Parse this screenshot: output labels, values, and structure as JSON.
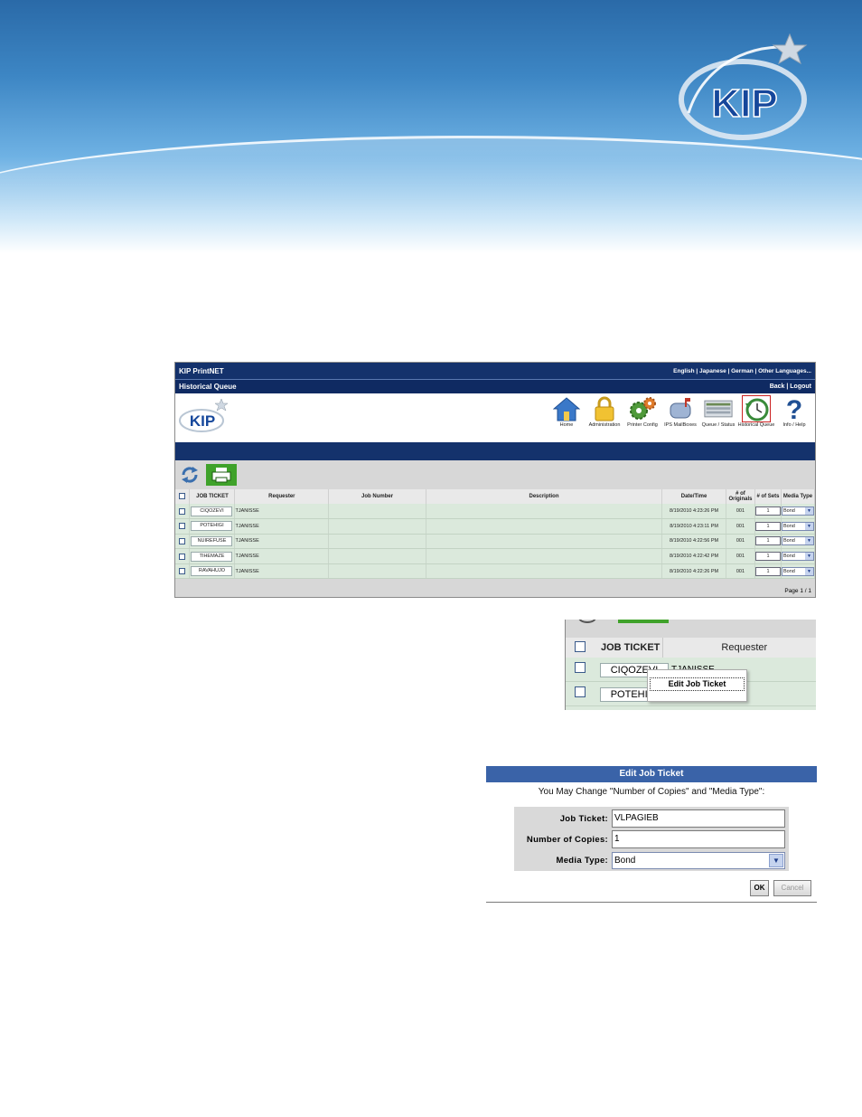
{
  "banner": {
    "logo_text": "KIP"
  },
  "app": {
    "title": "KIP PrintNET",
    "languages": "English | Japanese | German | Other Languages...",
    "page_name": "Historical Queue",
    "links": "Back | Logout",
    "logo_text": "KIP",
    "nav": [
      {
        "label": "Home",
        "icon": "home-icon"
      },
      {
        "label": "Administration",
        "icon": "lock-icon"
      },
      {
        "label": "Printer Config",
        "icon": "gears-icon"
      },
      {
        "label": "IPS MailBoxes",
        "icon": "mailbox-icon"
      },
      {
        "label": "Queue / Status",
        "icon": "queue-icon"
      },
      {
        "label": "Historical Queue",
        "icon": "history-clock-icon"
      },
      {
        "label": "Info / Help",
        "icon": "question-icon"
      }
    ],
    "columns": [
      "JOB TICKET",
      "Requester",
      "Job Number",
      "Description",
      "Date/Time",
      "# of Originals",
      "# of Sets",
      "Media Type"
    ],
    "rows": [
      {
        "ticket": "CIQOZEVI",
        "requester": "TJANISSE",
        "datetime": "8/19/2010 4:23:26 PM",
        "originals": "001",
        "sets": "1",
        "media": "Bond"
      },
      {
        "ticket": "POTEHIGI",
        "requester": "TJANISSE",
        "datetime": "8/19/2010 4:23:11 PM",
        "originals": "001",
        "sets": "1",
        "media": "Bond"
      },
      {
        "ticket": "NUIREFUSE",
        "requester": "TJANISSE",
        "datetime": "8/19/2010 4:22:56 PM",
        "originals": "001",
        "sets": "1",
        "media": "Bond"
      },
      {
        "ticket": "TIHEMAZE",
        "requester": "TJANISSE",
        "datetime": "8/19/2010 4:22:42 PM",
        "originals": "001",
        "sets": "1",
        "media": "Bond"
      },
      {
        "ticket": "RAVAHUJO",
        "requester": "TJANISSE",
        "datetime": "8/19/2010 4:22:26 PM",
        "originals": "001",
        "sets": "1",
        "media": "Bond"
      }
    ],
    "pager": "Page 1 / 1"
  },
  "zoom": {
    "col_ticket": "JOB TICKET",
    "col_requester": "Requester",
    "row1_ticket": "CIQOZEVI",
    "row1_requester": "TJANISSE",
    "row2_ticket": "POTEHIGI",
    "menu_item": "Edit Job Ticket"
  },
  "dialog": {
    "title": "Edit Job Ticket",
    "message": "You May Change \"Number of Copies\" and \"Media Type\":",
    "job_ticket_label": "Job Ticket:",
    "job_ticket_value": "VLPAGIEB",
    "copies_label": "Number of Copies:",
    "copies_value": "1",
    "media_label": "Media Type:",
    "media_value": "Bond",
    "ok_label": "OK",
    "cancel_label": "Cancel"
  }
}
